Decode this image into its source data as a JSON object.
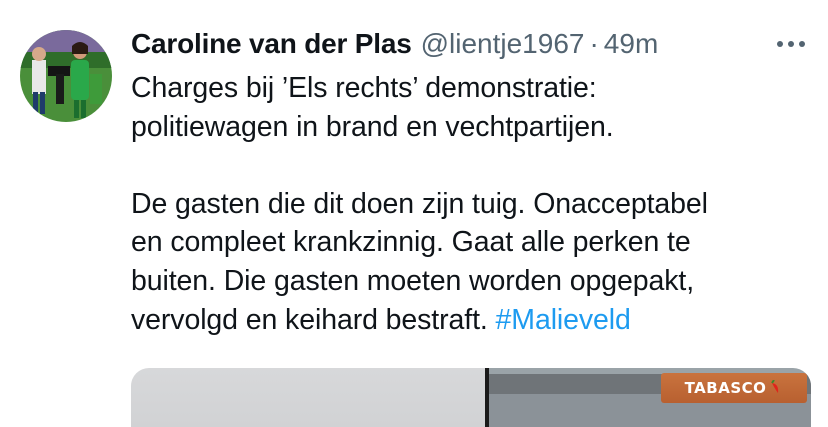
{
  "tweet": {
    "author": {
      "display_name": "Caroline van der Plas",
      "handle": "@lientje1967"
    },
    "separator": "·",
    "timestamp": "49m",
    "text_lines": [
      "Charges bij ’Els rechts’ demonstratie:",
      "politiewagen in brand en vechtpartijen."
    ],
    "text_lines_2": [
      "De gasten die dit doen zijn tuig. Onacceptabel",
      "en compleet krankzinnig. Gaat alle perken te",
      "buiten. Die gasten moeten worden opgepakt,"
    ],
    "last_line_text": "vervolgd en keihard bestraft.",
    "hashtag": "#Malieveld",
    "media": {
      "sign_text": "TABASCO"
    }
  },
  "icons": {
    "more": "more-horizontal-icon",
    "chili": "chili-pepper-icon"
  },
  "colors": {
    "text": "#0f1419",
    "secondary": "#536471",
    "link": "#1d9bf0"
  }
}
